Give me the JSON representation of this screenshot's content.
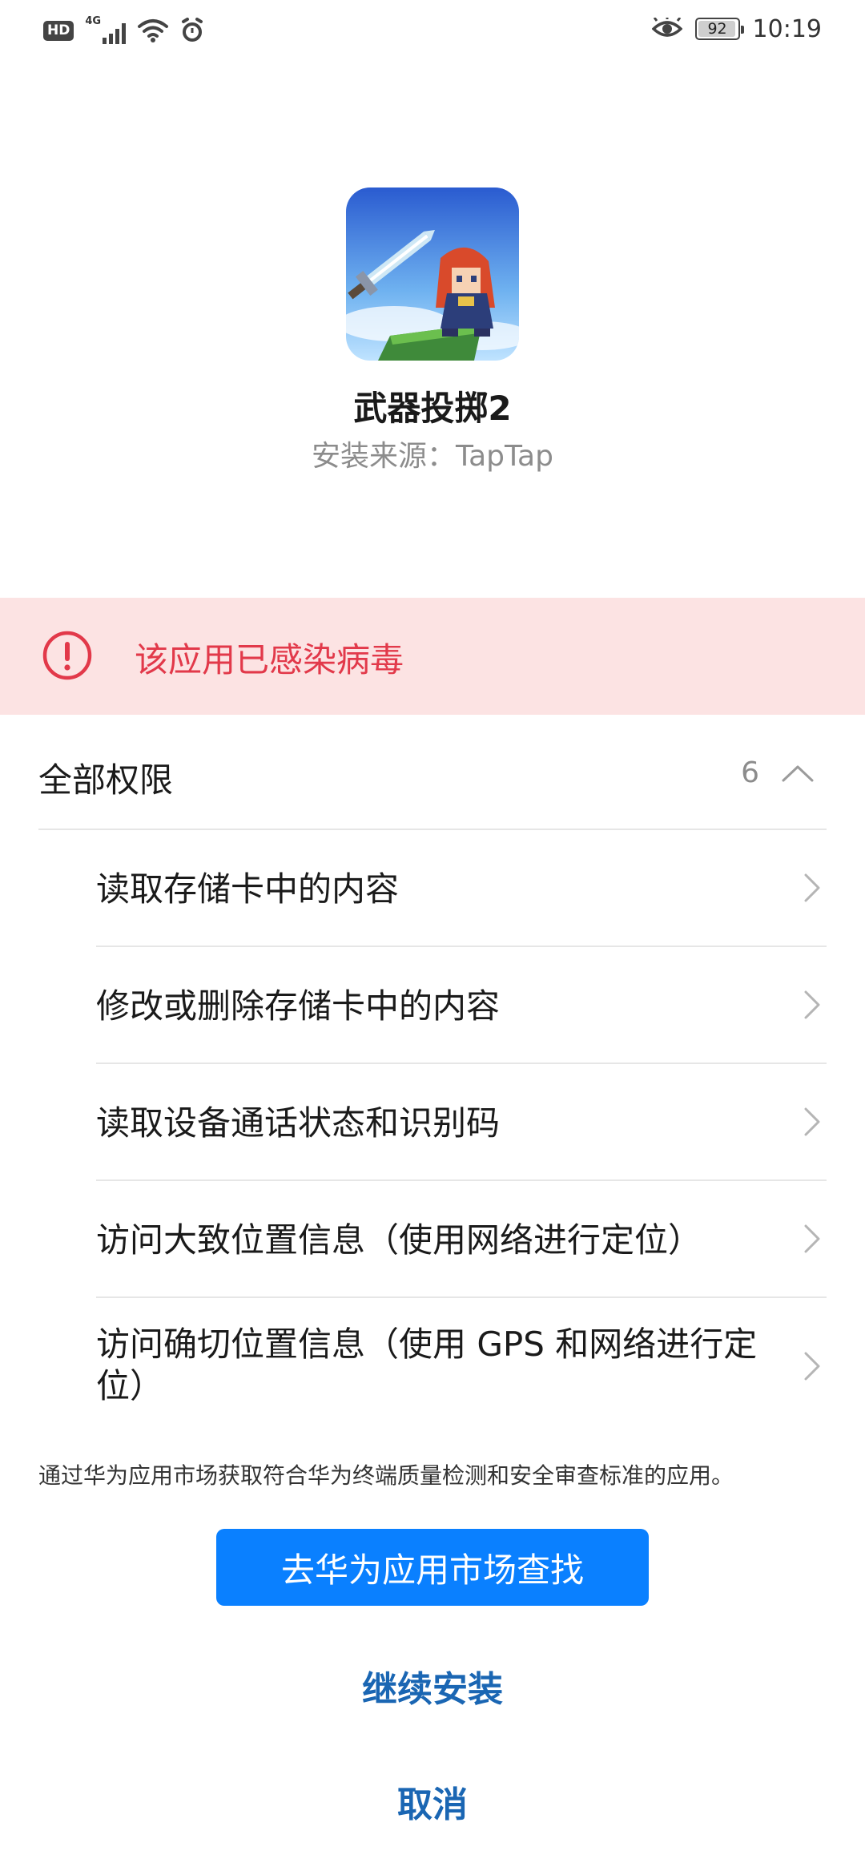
{
  "status_bar": {
    "hd_label": "HD",
    "network_label": "4G",
    "battery_level": "92",
    "time": "10:19",
    "icons": [
      "hd-icon",
      "signal-icon",
      "wifi-icon",
      "alarm-icon",
      "eye-icon",
      "battery-icon"
    ]
  },
  "app": {
    "name": "武器投掷2",
    "source": "安装来源：TapTap",
    "icon": "game-app-icon"
  },
  "warning": {
    "text": "该应用已感染病毒",
    "icon": "alert-circle-icon",
    "color": "#e2394a",
    "background": "#fce3e3"
  },
  "permissions": {
    "title": "全部权限",
    "count": "6",
    "expanded": true,
    "items": [
      {
        "label": "读取存储卡中的内容"
      },
      {
        "label": "修改或删除存储卡中的内容"
      },
      {
        "label": "读取设备通话状态和识别码"
      },
      {
        "label": "访问大致位置信息（使用网络进行定位）"
      },
      {
        "label": "访问确切位置信息（使用 GPS 和网络进行定位）"
      }
    ]
  },
  "footnote": "通过华为应用市场获取符合华为终端质量检测和安全审查标准的应用。",
  "actions": {
    "market_button": "去华为应用市场查找",
    "continue_button": "继续安装",
    "cancel_button": "取消"
  },
  "colors": {
    "primary_button": "#0a80ff",
    "link": "#1a66b3"
  }
}
